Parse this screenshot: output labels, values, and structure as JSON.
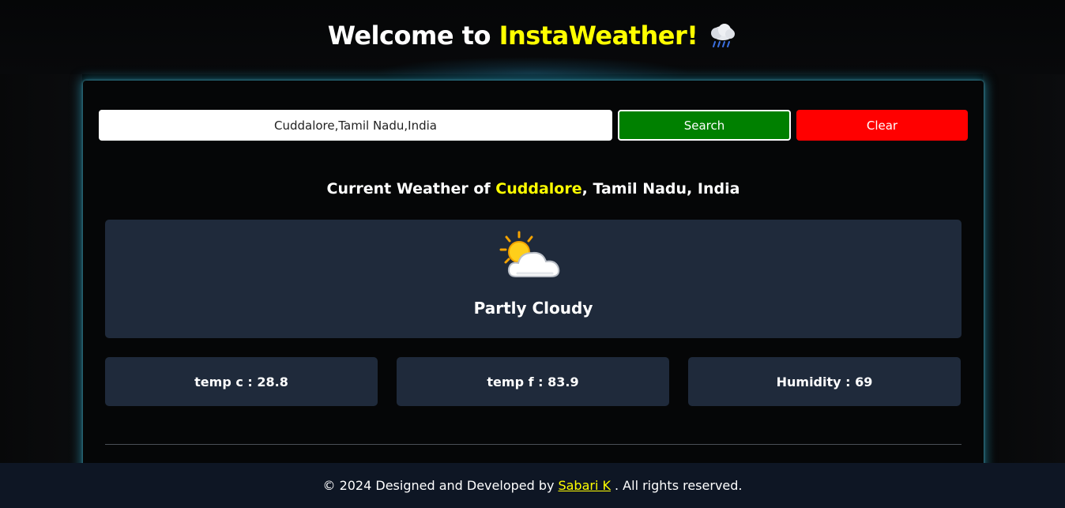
{
  "header": {
    "welcome": "Welcome to",
    "brand": "InstaWeather!",
    "icon": "rain-cloud-icon"
  },
  "search": {
    "value": "Cuddalore,Tamil Nadu,India",
    "search_label": "Search",
    "clear_label": "Clear"
  },
  "weather": {
    "heading_prefix": "Current Weather of",
    "city": "Cuddalore",
    "region_country": ", Tamil Nadu, India",
    "condition_icon": "partly-cloudy-icon",
    "condition": "Partly Cloudy",
    "temp_c": "temp c : 28.8",
    "temp_f": "temp f : 83.9",
    "humidity": "Humidity : 69"
  },
  "footer": {
    "prefix": "© 2024 Designed and Developed by",
    "author": "Sabari K",
    "suffix": ". All rights reserved."
  },
  "colors": {
    "accent_yellow": "#ffff00",
    "search_green": "#008000",
    "clear_red": "#ff0000",
    "card_bg": "#1f2a3b",
    "footer_bg": "#0e1624"
  }
}
